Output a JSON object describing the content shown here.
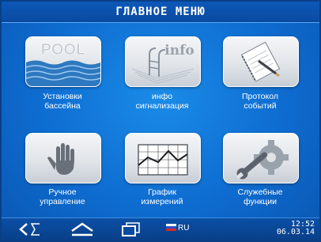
{
  "header": {
    "title": "ГЛАВНОЕ МЕНЮ"
  },
  "menu": {
    "tiles": [
      {
        "logo_text": "POOL",
        "line1": "Установки",
        "line2": "бассейна"
      },
      {
        "logo_text": "info",
        "line1": "инфо",
        "line2": "сигнализация"
      },
      {
        "line1": "Протокол",
        "line2": "событий"
      },
      {
        "line1": "Ручное",
        "line2": "управление"
      },
      {
        "line1": "График",
        "line2": "измерений"
      },
      {
        "line1": "Служебные",
        "line2": "функции"
      }
    ]
  },
  "statusbar": {
    "language": "RU",
    "time": "12:52",
    "date": "06.03.14"
  },
  "colors": {
    "background": "#0e6cd0",
    "bar": "#0a4aa0",
    "text": "#ffffff"
  }
}
